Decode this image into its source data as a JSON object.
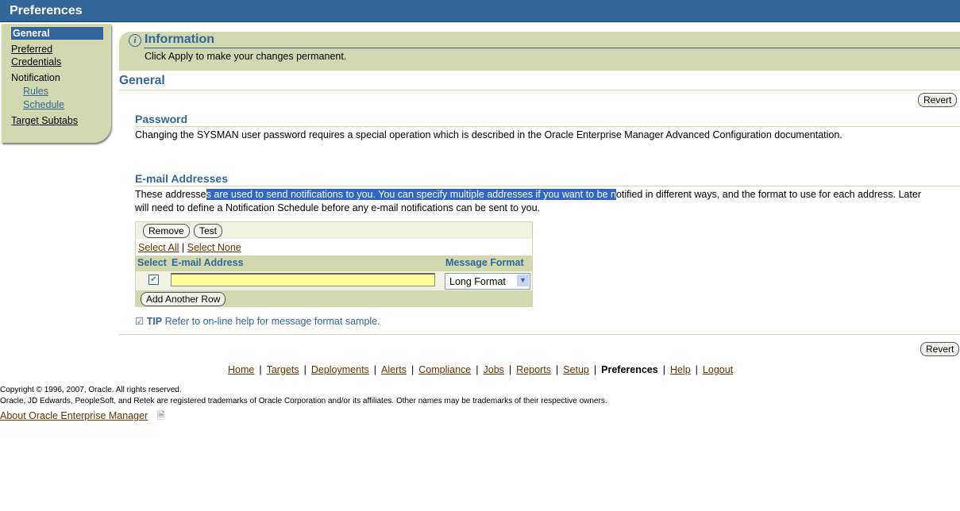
{
  "title": "Preferences",
  "sidebar": {
    "general": "General",
    "preferred": "Preferred",
    "credentials": "Credentials",
    "notification": "Notification",
    "rules": "Rules",
    "schedule": "Schedule",
    "target_subtabs": "Target Subtabs"
  },
  "info": {
    "title": "Information",
    "message": "Click Apply to make your changes permanent."
  },
  "section_title": "General",
  "revert": "Revert",
  "password": {
    "title": "Password",
    "text": "Changing the SYSMAN user password requires a special operation which is described in the Oracle Enterprise Manager Advanced Configuration documentation."
  },
  "email": {
    "title": "E-mail Addresses",
    "text_a": "These addresse",
    "text_selected": "s are used to send notifications to you. You can specify multiple addresses if you want to be n",
    "text_b": "otified in different ways, and the format to use for each address. Later",
    "text_line2": "will need to define a Notification Schedule before any e-mail notifications can be sent to you.",
    "remove": "Remove",
    "test": "Test",
    "select_all": "Select All",
    "select_none": "Select None",
    "col_select": "Select",
    "col_email": "E-mail Address",
    "col_format": "Message Format",
    "row": {
      "checked": true,
      "email": "",
      "format": "Long Format"
    },
    "add_row": "Add Another Row"
  },
  "tip": {
    "label": "TIP",
    "text": "Refer to on-line help for message format sample."
  },
  "footer": {
    "nav": [
      "Home",
      "Targets",
      "Deployments",
      "Alerts",
      "Compliance",
      "Jobs",
      "Reports",
      "Setup",
      "Preferences",
      "Help",
      "Logout"
    ],
    "current": "Preferences",
    "copyright": "Copyright © 1996, 2007, Oracle. All rights reserved.",
    "trademarks": "Oracle, JD Edwards, PeopleSoft, and Retek are registered trademarks of Oracle Corporation and/or its affiliates. Other names may be trademarks of their respective owners.",
    "about": "About Oracle Enterprise Manager"
  }
}
